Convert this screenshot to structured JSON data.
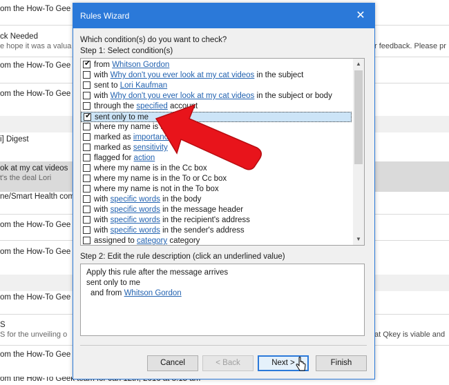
{
  "background": {
    "rows": [
      {
        "line1": "om the How-To Gee",
        "line2": ""
      },
      {
        "line1": "ck Needed",
        "line2": "e hope it was a valua",
        "line2_right": "r feedback. Please pr"
      },
      {
        "line1": "om the How-To Gee",
        "line2": ""
      },
      {
        "line1": "om the How-To Gee",
        "line2": ""
      },
      {
        "line1": "i] Digest",
        "line2": ""
      },
      {
        "line1": "ok at my cat videos",
        "line2": "t's the deal Lori"
      },
      {
        "line1": "ne/Smart Health com",
        "line2": ""
      },
      {
        "line1": "om the How-To Gee",
        "line2": ""
      },
      {
        "line1": "om the How-To Gee",
        "line2": ""
      },
      {
        "line1": "om the How-To Gee",
        "line2": ""
      },
      {
        "line1": "S",
        "line2": "S for the unveiling o",
        "line2_right": "at Qkey is viable and"
      },
      {
        "line1": "om the How-To Gee",
        "line2": ""
      },
      {
        "line1": "om the How-To Geek team for Jan 12th, 2016 at 8:15 am",
        "line2": ""
      }
    ]
  },
  "dialog": {
    "title": "Rules Wizard",
    "question": "Which condition(s) do you want to check?",
    "step1": "Step 1: Select condition(s)",
    "step2": "Step 2: Edit the rule description (click an underlined value)",
    "conditions": [
      {
        "checked": true,
        "pre": "from ",
        "link": "Whitson Gordon",
        "post": ""
      },
      {
        "checked": false,
        "pre": "with ",
        "link": "Why don't you ever look at my cat videos",
        "post": " in the subject"
      },
      {
        "checked": false,
        "pre": "sent to ",
        "link": "Lori Kaufman",
        "post": ""
      },
      {
        "checked": false,
        "pre": "with ",
        "link": "Why don't you ever look at my cat videos",
        "post": " in the subject or body"
      },
      {
        "checked": false,
        "pre": "through the ",
        "link": "specified",
        "post": " account"
      },
      {
        "checked": true,
        "pre": "sent only to me",
        "link": "",
        "post": "",
        "selected": true
      },
      {
        "checked": false,
        "pre": "where my name is in ",
        "link": "",
        "post": ""
      },
      {
        "checked": false,
        "pre": "marked as ",
        "link": "importance",
        "post": ""
      },
      {
        "checked": false,
        "pre": "marked as ",
        "link": "sensitivity",
        "post": ""
      },
      {
        "checked": false,
        "pre": "flagged for ",
        "link": "action",
        "post": ""
      },
      {
        "checked": false,
        "pre": "where my name is in the Cc box",
        "link": "",
        "post": ""
      },
      {
        "checked": false,
        "pre": "where my name is in the To or Cc box",
        "link": "",
        "post": ""
      },
      {
        "checked": false,
        "pre": "where my name is not in the To box",
        "link": "",
        "post": ""
      },
      {
        "checked": false,
        "pre": "with ",
        "link": "specific words",
        "post": " in the body"
      },
      {
        "checked": false,
        "pre": "with ",
        "link": "specific words",
        "post": " in the message header"
      },
      {
        "checked": false,
        "pre": "with ",
        "link": "specific words",
        "post": " in the recipient's address"
      },
      {
        "checked": false,
        "pre": "with ",
        "link": "specific words",
        "post": " in the sender's address"
      },
      {
        "checked": false,
        "pre": "assigned to ",
        "link": "category",
        "post": " category"
      }
    ],
    "description": {
      "line1": "Apply this rule after the message arrives",
      "line2": "sent only to me",
      "line3_pre": "and from ",
      "line3_link": "Whitson Gordon"
    },
    "buttons": {
      "cancel": "Cancel",
      "back": "< Back",
      "next": "Next >",
      "finish": "Finish"
    },
    "close_glyph": "✕",
    "check_glyph": "✔"
  },
  "colors": {
    "title_bar": "#2b79d9",
    "link": "#2262b0",
    "arrow": "#e8141b"
  }
}
